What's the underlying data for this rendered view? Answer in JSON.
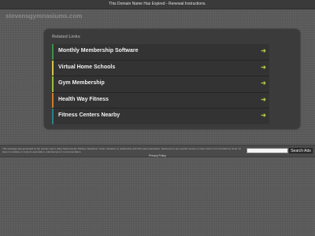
{
  "topbar": {
    "notice": "This Domain Name Has Expired - Renewal Instructions."
  },
  "domain": {
    "title": "stevensgymnasiums.com"
  },
  "related": {
    "title": "Related Links",
    "items": [
      {
        "label": "Monthly Membership Software",
        "color": "#3f8f4b"
      },
      {
        "label": "Virtual Home Schools",
        "color": "#d4c44a"
      },
      {
        "label": "Gym Membership",
        "color": "#9cbb3e"
      },
      {
        "label": "Health Way Fitness",
        "color": "#d07a2d"
      },
      {
        "label": "Fitness Centers Nearby",
        "color": "#2f7f86"
      }
    ],
    "arrow": "➜"
  },
  "footer": {
    "disclaimer": "This webpage was generated by the domain owner using Sedo Domain Parking. Disclaimer: Sedo maintains no relationship with third party advertisers. Reference to any specific service or trade mark is not controlled by Sedo nor does it constitute or imply its association, endorsement or recommendation.",
    "search_placeholder": "",
    "search_button": "Search Ads",
    "privacy": "Privacy Policy"
  }
}
